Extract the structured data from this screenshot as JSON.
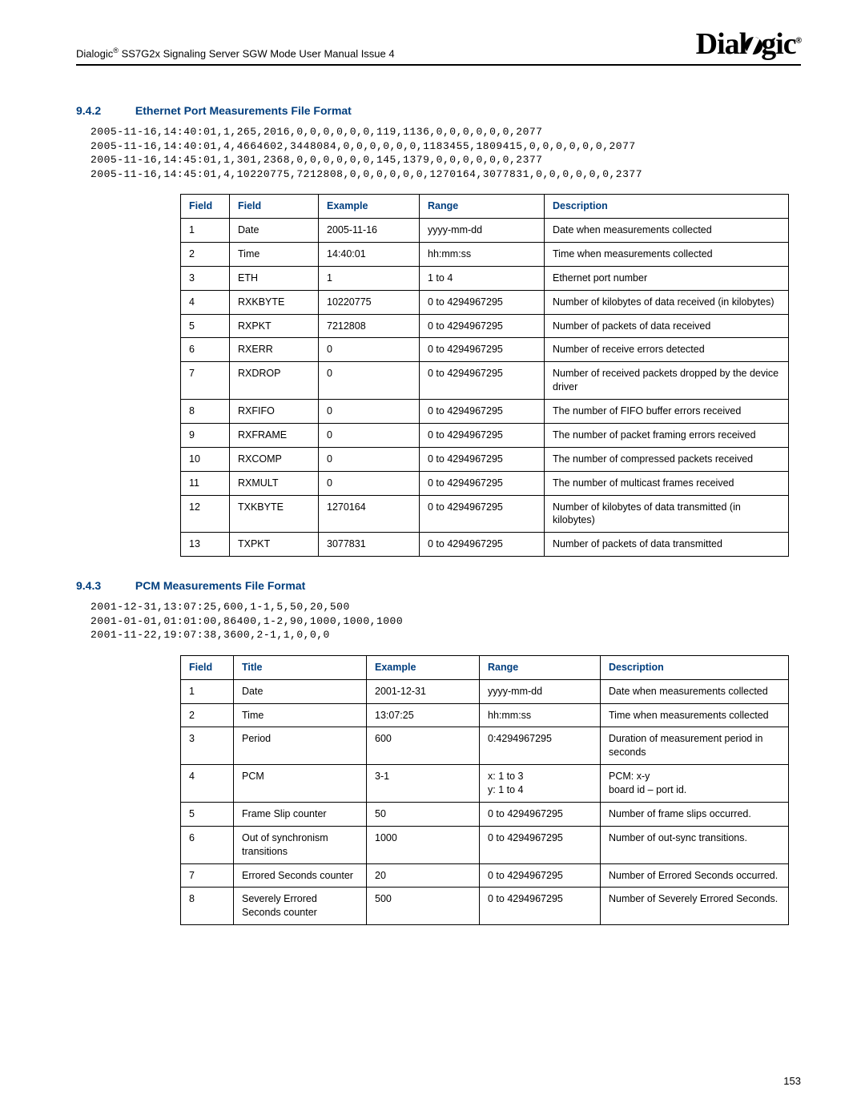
{
  "header": {
    "title_pre": "Dialogic",
    "title_post": " SS7G2x Signaling Server SGW Mode User Manual  Issue 4",
    "logo_text": "Dialogic"
  },
  "section942": {
    "num": "9.4.2",
    "title": "Ethernet Port Measurements File Format",
    "code": "2005-11-16,14:40:01,1,265,2016,0,0,0,0,0,0,119,1136,0,0,0,0,0,0,2077\n2005-11-16,14:40:01,4,4664602,3448084,0,0,0,0,0,0,1183455,1809415,0,0,0,0,0,0,2077\n2005-11-16,14:45:01,1,301,2368,0,0,0,0,0,0,145,1379,0,0,0,0,0,0,2377\n2005-11-16,14:45:01,4,10220775,7212808,0,0,0,0,0,0,1270164,3077831,0,0,0,0,0,0,2377",
    "headers": {
      "c1": "Field",
      "c2": "Field",
      "c3": "Example",
      "c4": "Range",
      "c5": "Description"
    },
    "rows": [
      {
        "c1": "1",
        "c2": "Date",
        "c3": "2005-11-16",
        "c4": "yyyy-mm-dd",
        "c5": "Date when measurements collected"
      },
      {
        "c1": "2",
        "c2": "Time",
        "c3": "14:40:01",
        "c4": "hh:mm:ss",
        "c5": "Time when measurements collected"
      },
      {
        "c1": "3",
        "c2": "ETH",
        "c3": "1",
        "c4": "1 to 4",
        "c5": "Ethernet port number"
      },
      {
        "c1": "4",
        "c2": "RXKBYTE",
        "c3": "10220775",
        "c4": "0 to 4294967295",
        "c5": "Number of kilobytes of data received (in kilobytes)"
      },
      {
        "c1": "5",
        "c2": "RXPKT",
        "c3": "7212808",
        "c4": "0 to 4294967295",
        "c5": "Number of packets of data received"
      },
      {
        "c1": "6",
        "c2": "RXERR",
        "c3": "0",
        "c4": "0 to 4294967295",
        "c5": "Number of receive errors detected"
      },
      {
        "c1": "7",
        "c2": "RXDROP",
        "c3": "0",
        "c4": "0 to 4294967295",
        "c5": "Number of received packets dropped by the device driver"
      },
      {
        "c1": "8",
        "c2": "RXFIFO",
        "c3": "0",
        "c4": "0 to 4294967295",
        "c5": "The number of FIFO buffer errors received"
      },
      {
        "c1": "9",
        "c2": "RXFRAME",
        "c3": "0",
        "c4": "0 to 4294967295",
        "c5": "The number of packet framing errors received"
      },
      {
        "c1": "10",
        "c2": "RXCOMP",
        "c3": "0",
        "c4": "0 to 4294967295",
        "c5": "The number of compressed packets received"
      },
      {
        "c1": "11",
        "c2": "RXMULT",
        "c3": "0",
        "c4": "0 to 4294967295",
        "c5": "The number of multicast frames received"
      },
      {
        "c1": "12",
        "c2": "TXKBYTE",
        "c3": "1270164",
        "c4": "0 to 4294967295",
        "c5": "Number of kilobytes of data transmitted (in kilobytes)"
      },
      {
        "c1": "13",
        "c2": "TXPKT",
        "c3": "3077831",
        "c4": "0 to 4294967295",
        "c5": "Number of packets of data transmitted"
      }
    ]
  },
  "section943": {
    "num": "9.4.3",
    "title": "PCM Measurements File Format",
    "code": "2001-12-31,13:07:25,600,1-1,5,50,20,500\n2001-01-01,01:01:00,86400,1-2,90,1000,1000,1000\n2001-11-22,19:07:38,3600,2-1,1,0,0,0",
    "headers": {
      "c1": "Field",
      "c2": "Title",
      "c3": "Example",
      "c4": "Range",
      "c5": "Description"
    },
    "rows": [
      {
        "c1": "1",
        "c2": "Date",
        "c3": "2001-12-31",
        "c4": "yyyy-mm-dd",
        "c5": "Date when measurements collected"
      },
      {
        "c1": "2",
        "c2": "Time",
        "c3": "13:07:25",
        "c4": "hh:mm:ss",
        "c5": "Time when measurements collected"
      },
      {
        "c1": "3",
        "c2": "Period",
        "c3": "600",
        "c4": "0:4294967295",
        "c5": "Duration of measurement period in seconds"
      },
      {
        "c1": "4",
        "c2": "PCM",
        "c3": "3-1",
        "c4": "x: 1 to 3\ny: 1 to 4",
        "c5": "PCM: x-y\nboard id – port id."
      },
      {
        "c1": "5",
        "c2": "Frame Slip counter",
        "c3": "50",
        "c4": "0 to 4294967295",
        "c5": "Number of frame slips occurred."
      },
      {
        "c1": "6",
        "c2": "Out of synchronism transitions",
        "c3": "1000",
        "c4": "0 to 4294967295",
        "c5": "Number of out-sync transitions."
      },
      {
        "c1": "7",
        "c2": "Errored Seconds counter",
        "c3": "20",
        "c4": "0 to 4294967295",
        "c5": "Number of Errored Seconds occurred."
      },
      {
        "c1": "8",
        "c2": "Severely Errored Seconds counter",
        "c3": "500",
        "c4": "0 to 4294967295",
        "c5": "Number of Severely Errored Seconds."
      }
    ]
  },
  "page_number": "153"
}
